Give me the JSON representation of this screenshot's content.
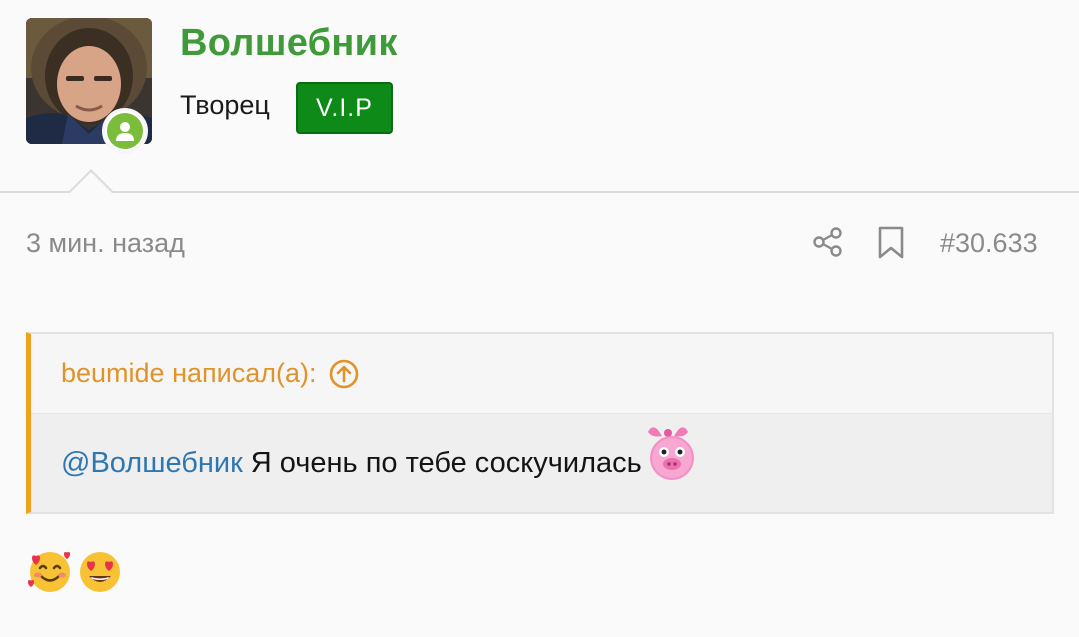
{
  "user": {
    "name": "Волшебник",
    "role": "Творец",
    "badge": "V.I.P",
    "online": true
  },
  "post": {
    "time": "3 мин. назад",
    "number": "#30.633",
    "actions": [
      "share-icon",
      "bookmark-icon"
    ]
  },
  "quote": {
    "author": "beumide написал(а):",
    "mention": "@Волшебник",
    "text": "Я очень по тебе соскучилась",
    "sticker": "pink-pig-smiley"
  },
  "reply": {
    "emojis": [
      "smiling-face-with-hearts",
      "heart-eyes"
    ]
  },
  "colors": {
    "username": "#3f9b3a",
    "vip_badge": "#0e8a19",
    "quote_author": "#e0932a",
    "quote_border": "#f0a21f",
    "mention": "#2f77b0",
    "meta": "#8a8a8a"
  }
}
